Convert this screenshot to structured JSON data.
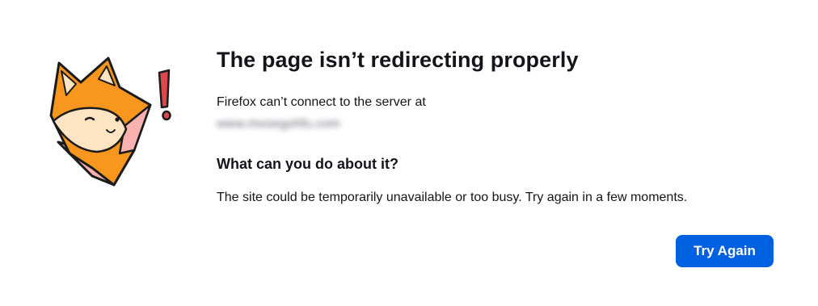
{
  "error": {
    "title": "The page isn’t redirecting properly",
    "message": "Firefox can’t connect to the server at",
    "server_url": "www.mooegohfu.com",
    "subtitle": "What can you do about it?",
    "advice": "The site could be temporarily unavailable or too busy. Try again in a few moments."
  },
  "actions": {
    "try_again_label": "Try Again"
  },
  "illustration": {
    "icon": "fox-with-exclamation-icon",
    "colors": {
      "fox_orange": "#f8961e",
      "fox_cream": "#fde5c4",
      "fox_pink": "#f9b2b0",
      "exclamation_red": "#e0474c"
    }
  },
  "colors": {
    "accent": "#0061e0",
    "text": "#15141a"
  }
}
